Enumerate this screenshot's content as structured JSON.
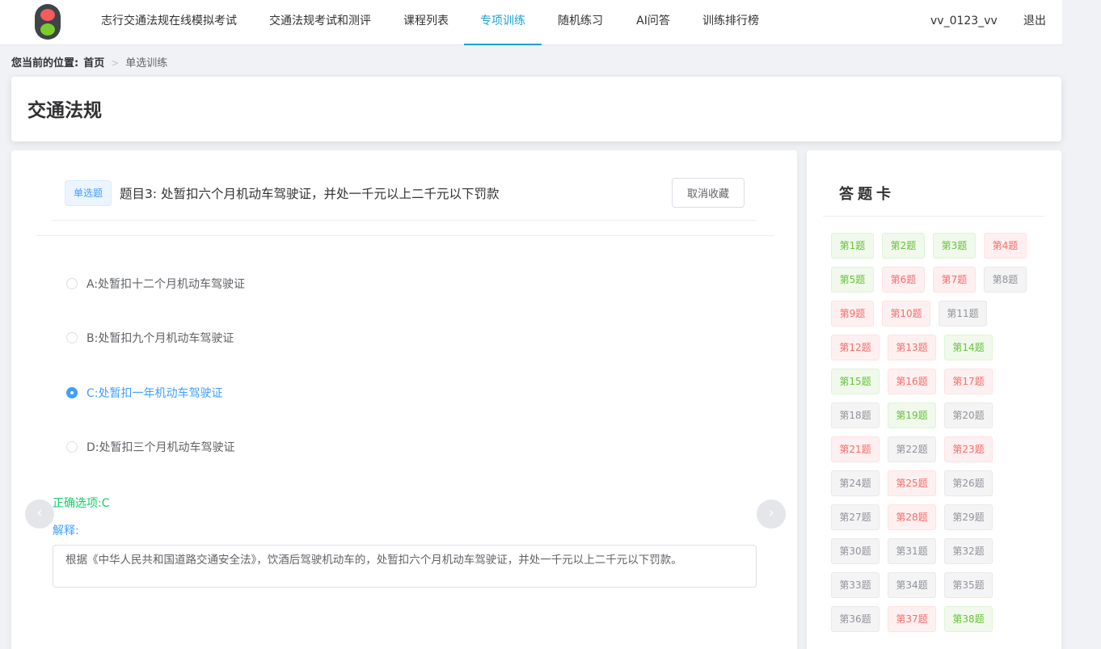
{
  "nav": {
    "logo": "traffic-light-icon",
    "items": [
      "志行交通法规在线模拟考试",
      "交通法规考试和测评",
      "课程列表",
      "专项训练",
      "随机练习",
      "AI问答",
      "训练排行榜"
    ],
    "active": "专项训练",
    "username": "vv_0123_vv",
    "logout": "退出"
  },
  "breadcrumb": {
    "prefix": "您当前的位置:",
    "home": "首页",
    "current": "单选训练"
  },
  "page_title": "交通法规",
  "question": {
    "type_tag": "单选题",
    "title": "题目3: 处暂扣六个月机动车驾驶证，并处一千元以上二千元以下罚款",
    "favorite_button": "取消收藏",
    "options": [
      {
        "label": "A:处暂扣十二个月机动车驾驶证",
        "checked": false
      },
      {
        "label": "B:处暂扣九个月机动车驾驶证",
        "checked": false
      },
      {
        "label": "C:处暂扣一年机动车驾驶证",
        "checked": true
      },
      {
        "label": "D:处暂扣三个月机动车驾驶证",
        "checked": false
      }
    ],
    "correct_answer": "正确选项:C",
    "explanation_label": "解释:",
    "explanation": "根据《中华人民共和国道路交通安全法》，饮酒后驾驶机动车的，处暂扣六个月机动车驾驶证，并处一千元以上二千元以下罚款。",
    "prev_icon": "chevron-left-icon",
    "next_icon": "chevron-right-icon"
  },
  "answer_card": {
    "title": "答题卡",
    "colors": {
      "correct": "#67c23a",
      "wrong": "#f56c6c",
      "unanswered": "#909399"
    },
    "rows": [
      [
        {
          "label": "第1题",
          "status": "green"
        },
        {
          "label": "第2题",
          "status": "green"
        },
        {
          "label": "第3题",
          "status": "green"
        },
        {
          "label": "第4题",
          "status": "red"
        }
      ],
      [
        {
          "label": "第5题",
          "status": "green"
        },
        {
          "label": "第6题",
          "status": "red"
        },
        {
          "label": "第7题",
          "status": "red"
        },
        {
          "label": "第8题",
          "status": "gray"
        }
      ],
      [
        {
          "label": "第9题",
          "status": "red"
        },
        {
          "label": "第10题",
          "status": "red"
        },
        {
          "label": "第11题",
          "status": "gray"
        }
      ],
      [
        {
          "label": "第12题",
          "status": "red"
        },
        {
          "label": "第13题",
          "status": "red"
        },
        {
          "label": "第14题",
          "status": "green"
        }
      ],
      [
        {
          "label": "第15题",
          "status": "green"
        },
        {
          "label": "第16题",
          "status": "red"
        },
        {
          "label": "第17题",
          "status": "red"
        }
      ],
      [
        {
          "label": "第18题",
          "status": "gray"
        },
        {
          "label": "第19题",
          "status": "green"
        },
        {
          "label": "第20题",
          "status": "gray"
        }
      ],
      [
        {
          "label": "第21题",
          "status": "red"
        },
        {
          "label": "第22题",
          "status": "gray"
        },
        {
          "label": "第23题",
          "status": "red"
        }
      ],
      [
        {
          "label": "第24题",
          "status": "gray"
        },
        {
          "label": "第25题",
          "status": "red"
        },
        {
          "label": "第26题",
          "status": "gray"
        }
      ],
      [
        {
          "label": "第27题",
          "status": "gray"
        },
        {
          "label": "第28题",
          "status": "red"
        },
        {
          "label": "第29题",
          "status": "gray"
        }
      ],
      [
        {
          "label": "第30题",
          "status": "gray"
        },
        {
          "label": "第31题",
          "status": "gray"
        },
        {
          "label": "第32题",
          "status": "gray"
        }
      ],
      [
        {
          "label": "第33题",
          "status": "gray"
        },
        {
          "label": "第34题",
          "status": "gray"
        },
        {
          "label": "第35题",
          "status": "gray"
        }
      ],
      [
        {
          "label": "第36题",
          "status": "gray"
        },
        {
          "label": "第37题",
          "status": "red"
        },
        {
          "label": "第38题",
          "status": "green"
        }
      ]
    ]
  }
}
